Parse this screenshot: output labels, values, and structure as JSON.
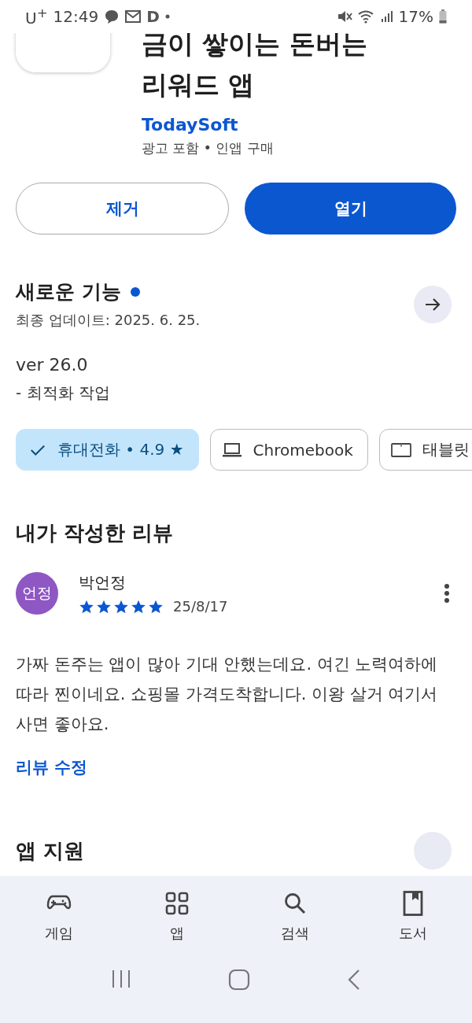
{
  "status_bar": {
    "carrier": "U$^{+}$",
    "time": "12:49",
    "app_letter": "D",
    "battery": "17%"
  },
  "app": {
    "title": "금이 쌓이는 돈버는 리워드 앱",
    "developer": "TodaySoft",
    "notes": "광고 포함 • 인앱 구매"
  },
  "actions": [
    {
      "label": "제거",
      "kind": "outline"
    },
    {
      "label": "열기",
      "kind": "filled"
    }
  ],
  "whats_new": {
    "title": "새로운 기능",
    "updated": "최종 업데이트: 2025. 6. 25.",
    "version": "ver 26.0",
    "details": "- 최적화 작업"
  },
  "device_chips": [
    {
      "label": "휴대전화 • 4.9 ★",
      "kind": "phone",
      "selected": true
    },
    {
      "label": "Chromebook",
      "kind": "laptop",
      "selected": false
    },
    {
      "label": "태블릿",
      "kind": "tablet",
      "selected": false
    }
  ],
  "my_review": {
    "heading": "내가 작성한 리뷰",
    "avatar": "언정",
    "author": "박언정",
    "stars": 5,
    "date": "25/8/17",
    "text": "가짜 돈주는 앱이 많아 기대 안했는데요. 여긴 노력여하에 따라 찐이네요. 쇼핑몰 가격도착합니다. 이왕 살거 여기서 사면 좋아요.",
    "edit_link": "리뷰 수정"
  },
  "app_support": {
    "heading": "앱 지원"
  },
  "bottom_nav": [
    {
      "label": "게임",
      "kind": "games",
      "selected": false
    },
    {
      "label": "앱",
      "kind": "apps",
      "selected": false
    },
    {
      "label": "검색",
      "kind": "search",
      "selected": false
    },
    {
      "label": "도서",
      "kind": "books",
      "selected": false
    }
  ]
}
